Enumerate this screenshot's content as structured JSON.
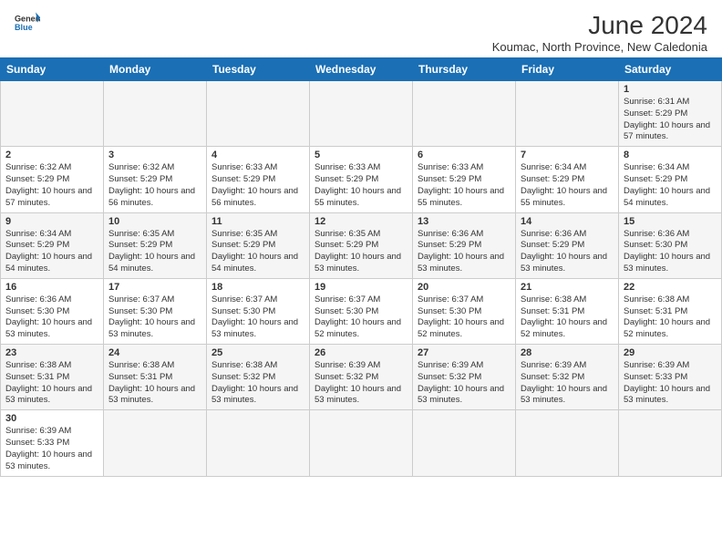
{
  "header": {
    "title": "June 2024",
    "location": "Koumac, North Province, New Caledonia",
    "logo_general": "General",
    "logo_blue": "Blue"
  },
  "days_of_week": [
    "Sunday",
    "Monday",
    "Tuesday",
    "Wednesday",
    "Thursday",
    "Friday",
    "Saturday"
  ],
  "weeks": [
    [
      {
        "day": "",
        "info": ""
      },
      {
        "day": "",
        "info": ""
      },
      {
        "day": "",
        "info": ""
      },
      {
        "day": "",
        "info": ""
      },
      {
        "day": "",
        "info": ""
      },
      {
        "day": "",
        "info": ""
      },
      {
        "day": "1",
        "info": "Sunrise: 6:31 AM\nSunset: 5:29 PM\nDaylight: 10 hours and 57 minutes."
      }
    ],
    [
      {
        "day": "2",
        "info": "Sunrise: 6:32 AM\nSunset: 5:29 PM\nDaylight: 10 hours and 57 minutes."
      },
      {
        "day": "3",
        "info": "Sunrise: 6:32 AM\nSunset: 5:29 PM\nDaylight: 10 hours and 56 minutes."
      },
      {
        "day": "4",
        "info": "Sunrise: 6:33 AM\nSunset: 5:29 PM\nDaylight: 10 hours and 56 minutes."
      },
      {
        "day": "5",
        "info": "Sunrise: 6:33 AM\nSunset: 5:29 PM\nDaylight: 10 hours and 55 minutes."
      },
      {
        "day": "6",
        "info": "Sunrise: 6:33 AM\nSunset: 5:29 PM\nDaylight: 10 hours and 55 minutes."
      },
      {
        "day": "7",
        "info": "Sunrise: 6:34 AM\nSunset: 5:29 PM\nDaylight: 10 hours and 55 minutes."
      },
      {
        "day": "8",
        "info": "Sunrise: 6:34 AM\nSunset: 5:29 PM\nDaylight: 10 hours and 54 minutes."
      }
    ],
    [
      {
        "day": "9",
        "info": "Sunrise: 6:34 AM\nSunset: 5:29 PM\nDaylight: 10 hours and 54 minutes."
      },
      {
        "day": "10",
        "info": "Sunrise: 6:35 AM\nSunset: 5:29 PM\nDaylight: 10 hours and 54 minutes."
      },
      {
        "day": "11",
        "info": "Sunrise: 6:35 AM\nSunset: 5:29 PM\nDaylight: 10 hours and 54 minutes."
      },
      {
        "day": "12",
        "info": "Sunrise: 6:35 AM\nSunset: 5:29 PM\nDaylight: 10 hours and 53 minutes."
      },
      {
        "day": "13",
        "info": "Sunrise: 6:36 AM\nSunset: 5:29 PM\nDaylight: 10 hours and 53 minutes."
      },
      {
        "day": "14",
        "info": "Sunrise: 6:36 AM\nSunset: 5:29 PM\nDaylight: 10 hours and 53 minutes."
      },
      {
        "day": "15",
        "info": "Sunrise: 6:36 AM\nSunset: 5:30 PM\nDaylight: 10 hours and 53 minutes."
      }
    ],
    [
      {
        "day": "16",
        "info": "Sunrise: 6:36 AM\nSunset: 5:30 PM\nDaylight: 10 hours and 53 minutes."
      },
      {
        "day": "17",
        "info": "Sunrise: 6:37 AM\nSunset: 5:30 PM\nDaylight: 10 hours and 53 minutes."
      },
      {
        "day": "18",
        "info": "Sunrise: 6:37 AM\nSunset: 5:30 PM\nDaylight: 10 hours and 53 minutes."
      },
      {
        "day": "19",
        "info": "Sunrise: 6:37 AM\nSunset: 5:30 PM\nDaylight: 10 hours and 52 minutes."
      },
      {
        "day": "20",
        "info": "Sunrise: 6:37 AM\nSunset: 5:30 PM\nDaylight: 10 hours and 52 minutes."
      },
      {
        "day": "21",
        "info": "Sunrise: 6:38 AM\nSunset: 5:31 PM\nDaylight: 10 hours and 52 minutes."
      },
      {
        "day": "22",
        "info": "Sunrise: 6:38 AM\nSunset: 5:31 PM\nDaylight: 10 hours and 52 minutes."
      }
    ],
    [
      {
        "day": "23",
        "info": "Sunrise: 6:38 AM\nSunset: 5:31 PM\nDaylight: 10 hours and 53 minutes."
      },
      {
        "day": "24",
        "info": "Sunrise: 6:38 AM\nSunset: 5:31 PM\nDaylight: 10 hours and 53 minutes."
      },
      {
        "day": "25",
        "info": "Sunrise: 6:38 AM\nSunset: 5:32 PM\nDaylight: 10 hours and 53 minutes."
      },
      {
        "day": "26",
        "info": "Sunrise: 6:39 AM\nSunset: 5:32 PM\nDaylight: 10 hours and 53 minutes."
      },
      {
        "day": "27",
        "info": "Sunrise: 6:39 AM\nSunset: 5:32 PM\nDaylight: 10 hours and 53 minutes."
      },
      {
        "day": "28",
        "info": "Sunrise: 6:39 AM\nSunset: 5:32 PM\nDaylight: 10 hours and 53 minutes."
      },
      {
        "day": "29",
        "info": "Sunrise: 6:39 AM\nSunset: 5:33 PM\nDaylight: 10 hours and 53 minutes."
      }
    ],
    [
      {
        "day": "30",
        "info": "Sunrise: 6:39 AM\nSunset: 5:33 PM\nDaylight: 10 hours and 53 minutes."
      },
      {
        "day": "",
        "info": ""
      },
      {
        "day": "",
        "info": ""
      },
      {
        "day": "",
        "info": ""
      },
      {
        "day": "",
        "info": ""
      },
      {
        "day": "",
        "info": ""
      },
      {
        "day": "",
        "info": ""
      }
    ]
  ]
}
